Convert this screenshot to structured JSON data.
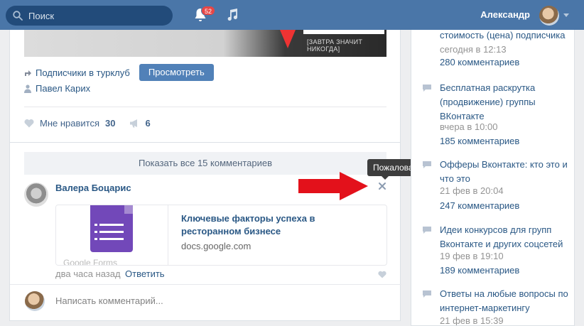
{
  "header": {
    "search_placeholder": "Поиск",
    "notifications_count": "52",
    "user_name": "Александр"
  },
  "post": {
    "banner_text": "[ЗАВТРА ЗНАЧИТ НИКОГДА]",
    "subscribers_label": "Подписчики в турклуб",
    "view_button": "Просмотреть",
    "author": "Павел Карих",
    "like_label": "Мне нравится",
    "like_count": "30",
    "share_count": "6"
  },
  "comments": {
    "show_all": "Показать все 15 комментариев",
    "tooltip": "Пожаловаться",
    "author": "Валера Боцарис",
    "link_title": "Ключевые факторы успеха в ресторанном бизнесе",
    "link_domain": "docs.google.com",
    "link_thumb_text": "Google Forms",
    "time": "два часа назад",
    "reply": "Ответить",
    "write_placeholder": "Написать комментарий..."
  },
  "sidebar": {
    "items": [
      {
        "title": "стоимость (цена) подписчика",
        "date": "сегодня в 12:13",
        "comments": "280 комментариев"
      },
      {
        "title": "Бесплатная раскрутка (продвижение) группы ВКонтакте",
        "date": "вчера в 10:00",
        "comments": "185 комментариев"
      },
      {
        "title": "Офферы Вконтакте: кто это и что это",
        "date": "21 фев в 20:04",
        "comments": "247 комментариев"
      },
      {
        "title": "Идеи конкурсов для групп Вконтакте и других соцсетей",
        "date": "19 фев в 19:10",
        "comments": "189 комментариев"
      },
      {
        "title": "Ответы на любые вопросы по интернет-маркетингу",
        "date": "21 фев в 15:39",
        "comments": ""
      }
    ]
  },
  "colors": {
    "header_bg": "#4a76a8",
    "link": "#2a5885",
    "button": "#5181b8",
    "badge": "#e64646",
    "arrow": "#e3111b"
  }
}
